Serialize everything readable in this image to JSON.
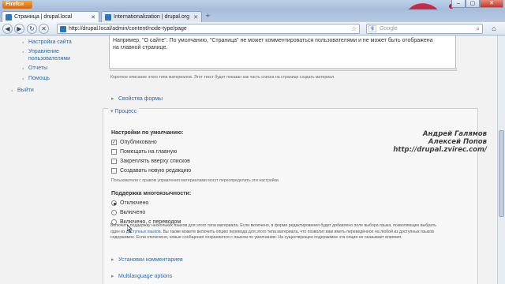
{
  "browser": {
    "app_button": "Firefox",
    "tabs": [
      {
        "title": "Страница | drupal.local",
        "active": true
      },
      {
        "title": "Internationalization | drupal.org",
        "active": false
      }
    ],
    "url": "http://drupal.local/admin/content/node-type/page",
    "search_placeholder": "Google",
    "window_controls": [
      "–",
      "▢",
      "✕"
    ]
  },
  "sidebar": {
    "items": [
      {
        "label": "Настройка сайта"
      },
      {
        "label": "Управление"
      },
      {
        "label": "пользователями"
      },
      {
        "label": "Отчеты"
      },
      {
        "label": "Помощь"
      },
      {
        "label": "Выйти"
      }
    ]
  },
  "form": {
    "textarea_line1": "Например, \"О сайте\". По умолчанию, \"Страница\" не может комментироваться пользователями и не может быть отображена",
    "textarea_line2": "на главной странице.",
    "textarea_desc": "Короткое описание этого типа материалов. Этот текст будет показан как часть списка на странице создать материал.",
    "fieldset_form": "Свойства формы",
    "fieldset_process": "Процесс",
    "defaults_label": "Настройки по умолчанию:",
    "defaults": [
      {
        "label": "Опубликовано",
        "checked": true
      },
      {
        "label": "Помещать на главную",
        "checked": false
      },
      {
        "label": "Закреплять вверху списков",
        "checked": false
      },
      {
        "label": "Создавать новую редакцию",
        "checked": false
      }
    ],
    "defaults_desc": "Пользователи с правом управления материалами могут переопределить эти настройки.",
    "multilang_label": "Поддержка многоязычности:",
    "multilang": [
      {
        "label": "Отключено",
        "selected": true
      },
      {
        "label": "Включено",
        "selected": false
      },
      {
        "label": "Включено, с переводом",
        "selected": false
      }
    ],
    "multilang_desc_1": "Включить поддержку нескольких языков для этого типа материала. Если включено, в форме редактирования будет добавлено поле выбора языка, позволяющее выбрать",
    "multilang_desc_2a": "один из ",
    "multilang_desc_link": "доступных языков",
    "multilang_desc_2b": ". Вы также можете включить опцию перевода для этого типа материала, что позволит вам иметь переведённое на любой из доступных языков",
    "multilang_desc_3": "содержимое. Если отключено, новые сообщения сохраняются с языком по умолчанию. На существующее содержимое эта опция не оказывает влияния.",
    "fieldset_comments": "Установки комментариев",
    "fieldset_multilang": "Multilanguage options"
  },
  "overlay": {
    "line1": "Андрей Галямов",
    "line2": "Алексей Попов",
    "line3": "http://drupal.zvirec.com/"
  }
}
